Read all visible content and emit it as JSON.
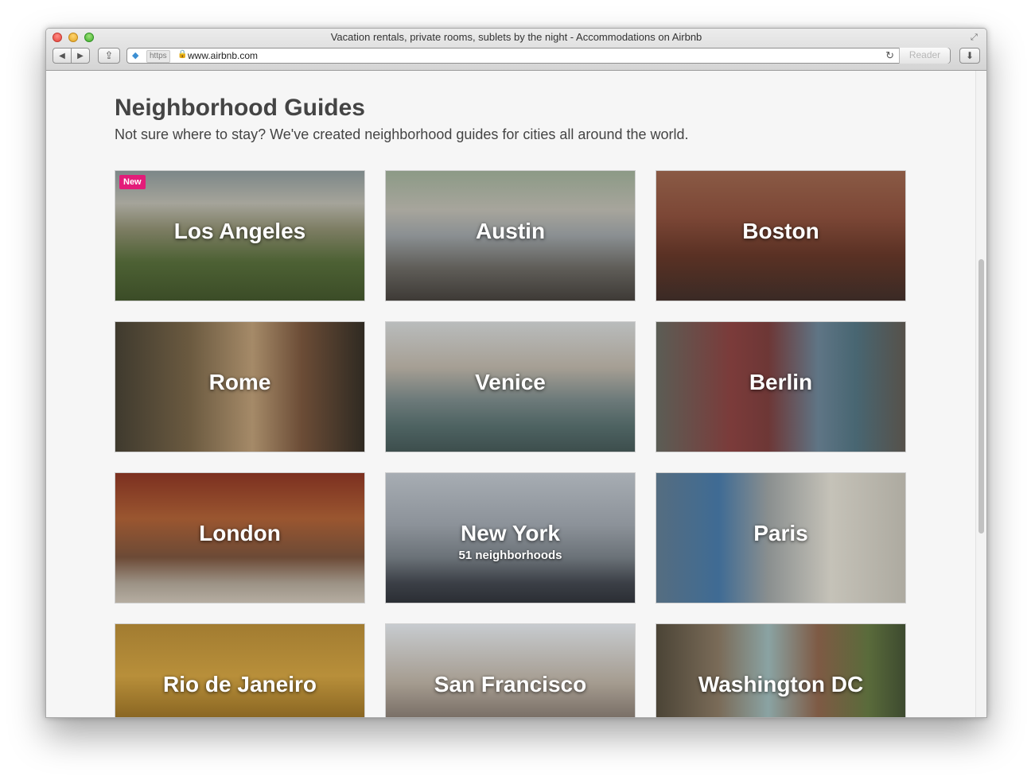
{
  "window": {
    "title": "Vacation rentals, private rooms, sublets by the night - Accommodations on Airbnb",
    "url_scheme": "https",
    "url": "www.airbnb.com",
    "reader_label": "Reader"
  },
  "page": {
    "title": "Neighborhood Guides",
    "subtitle": "Not sure where to stay? We've created neighborhood guides for cities all around the world."
  },
  "guides": [
    {
      "city": "Los Angeles",
      "badge": "New"
    },
    {
      "city": "Austin"
    },
    {
      "city": "Boston"
    },
    {
      "city": "Rome"
    },
    {
      "city": "Venice"
    },
    {
      "city": "Berlin"
    },
    {
      "city": "London"
    },
    {
      "city": "New York",
      "subtitle": "51 neighborhoods"
    },
    {
      "city": "Paris"
    },
    {
      "city": "Rio de Janeiro"
    },
    {
      "city": "San Francisco"
    },
    {
      "city": "Washington DC"
    }
  ],
  "colors": {
    "badge": "#e31c79",
    "heading": "#444444",
    "page_background": "#f6f6f6"
  }
}
